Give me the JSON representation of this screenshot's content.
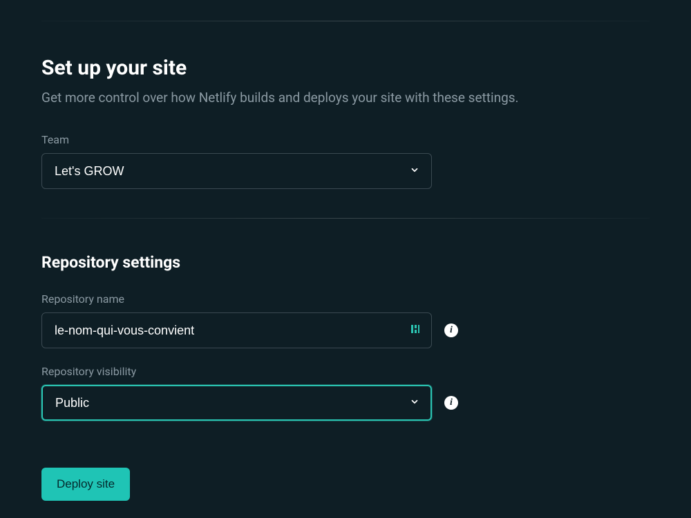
{
  "page": {
    "title": "Set up your site",
    "subtitle": "Get more control over how Netlify builds and deploys your site with these settings."
  },
  "team": {
    "label": "Team",
    "selected": "Let's GROW"
  },
  "repo": {
    "section_title": "Repository settings",
    "name_label": "Repository name",
    "name_value": "le-nom-qui-vous-convient",
    "visibility_label": "Repository visibility",
    "visibility_selected": "Public"
  },
  "actions": {
    "deploy_label": "Deploy site"
  },
  "info_glyph": "i"
}
